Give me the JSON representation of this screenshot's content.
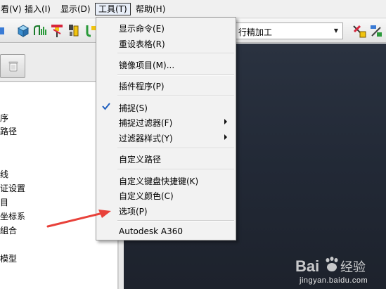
{
  "menubar": {
    "items": [
      {
        "label": "看(V)"
      },
      {
        "label": "插入(I)"
      },
      {
        "label": "显示(D)"
      },
      {
        "label": "工具(T)"
      },
      {
        "label": "帮助(H)"
      }
    ]
  },
  "toolbar": {
    "combo_value": "行精加工",
    "icons": [
      "cube-icon",
      "curve-icon",
      "drill-tool-icon",
      "tool-holder-icon",
      "hammer-icon",
      "probe-icon",
      "settings-wrench-icon"
    ]
  },
  "left_panel": {
    "tree_items": [
      {
        "label": "序"
      },
      {
        "label": "路径"
      },
      {
        "label": "线"
      },
      {
        "label": "证设置"
      },
      {
        "label": "目"
      },
      {
        "label": "坐标系"
      },
      {
        "label": "組合"
      },
      {
        "label": "模型"
      }
    ]
  },
  "dropdown": {
    "items": [
      {
        "label": "显示命令(E)"
      },
      {
        "label": "重设表格(R)"
      },
      {
        "label": "镜像项目(M)..."
      },
      {
        "label": "插件程序(P)"
      },
      {
        "label": "捕捉(S)",
        "checked": true
      },
      {
        "label": "捕捉过滤器(F)",
        "submenu": true
      },
      {
        "label": "过滤器样式(Y)",
        "submenu": true
      },
      {
        "label": "自定义路径"
      },
      {
        "label": "自定义键盘快捷键(K)"
      },
      {
        "label": "自定义颜色(C)"
      },
      {
        "label": "选项(P)"
      },
      {
        "label": "Autodesk A360"
      }
    ]
  },
  "colors": {
    "viewport_background": "#232a36",
    "annotation_arrow": "#e8413a",
    "menu_background": "#f2f2f2",
    "check_color": "#1f5fbf"
  },
  "watermark": {
    "logo_text": "Bai 经验",
    "url": "jingyan.baidu.com"
  }
}
